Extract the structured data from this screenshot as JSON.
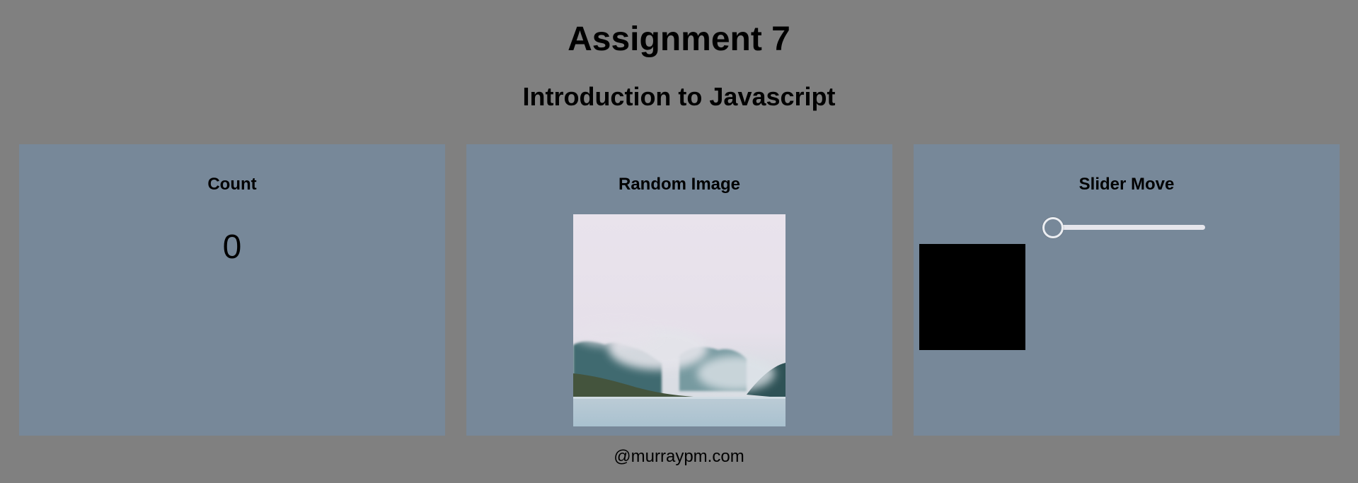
{
  "header": {
    "title": "Assignment 7",
    "subtitle": "Introduction to Javascript"
  },
  "panels": {
    "count": {
      "title": "Count",
      "value": "0"
    },
    "random_image": {
      "title": "Random Image",
      "image_description": "misty forested island over calm water"
    },
    "slider_move": {
      "title": "Slider Move",
      "slider_value_fraction": 0,
      "box_color": "#000000"
    }
  },
  "footer": {
    "text": "@murraypm.com"
  },
  "colors": {
    "background": "#808080",
    "panel": "#778899",
    "slider_track": "#e6e6ec"
  }
}
